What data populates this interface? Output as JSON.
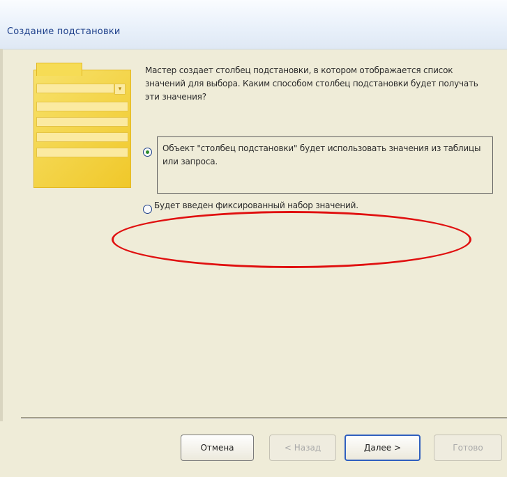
{
  "window": {
    "title": "Создание подстановки"
  },
  "wizard": {
    "description": "Мастер создает столбец подстановки, в котором отображается список значений для выбора.  Каким способом столбец подстановки будет получать эти значения?",
    "options": [
      {
        "label": "Объект \"столбец подстановки\" будет использовать значения из таблицы или запроса.",
        "checked": true
      },
      {
        "label": "Будет введен фиксированный набор значений.",
        "checked": false
      }
    ],
    "highlight_color": "#e01010"
  },
  "buttons": {
    "cancel": "Отмена",
    "back": "< Назад",
    "next": "Далее >",
    "finish": "Готово"
  },
  "colors": {
    "title_text": "#1d3f8a",
    "dialog_bg": "#efecd8",
    "illustration": "#f0c82a"
  }
}
